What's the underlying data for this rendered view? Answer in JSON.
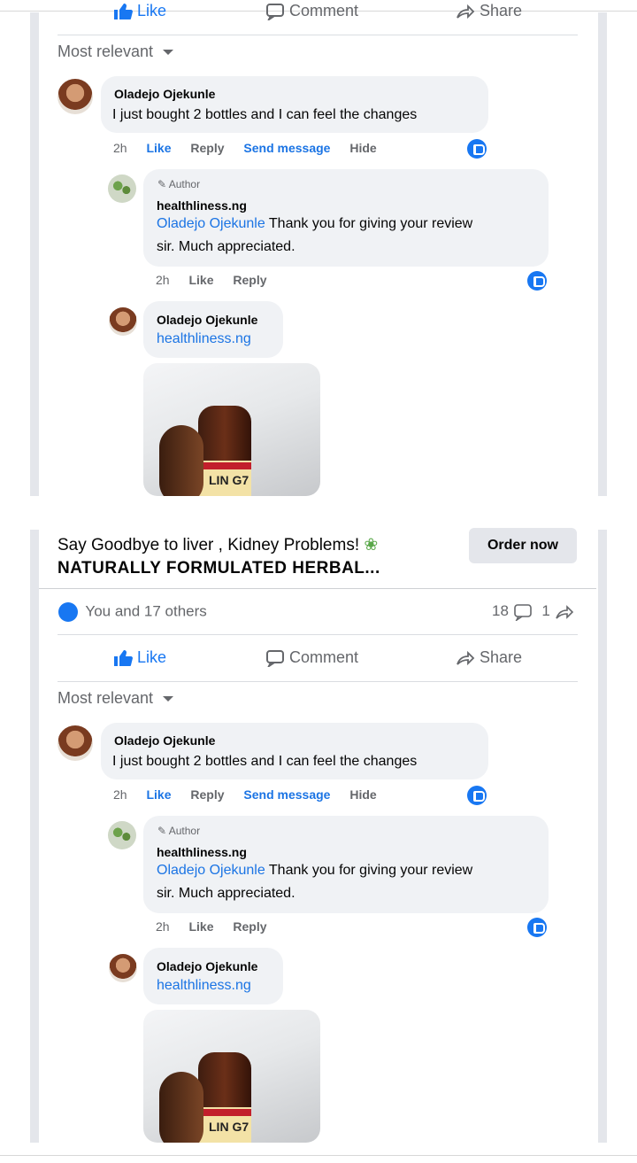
{
  "post": {
    "headline": "Say Goodbye to liver , Kidney Problems!",
    "subheadline": "NATURALLY FORMULATED HERBAL...",
    "cta_label": "Order now",
    "reactions_text": "You and 17 others",
    "comment_count": "18",
    "share_count": "1",
    "actions": {
      "like": "Like",
      "comment": "Comment",
      "share": "Share"
    },
    "sort_label": "Most relevant"
  },
  "comment": {
    "author": "Oladejo Ojekunle",
    "text": "I just bought 2 bottles and I can feel the changes",
    "time": "2h",
    "like": "Like",
    "reply": "Reply",
    "send_message": "Send message",
    "hide": "Hide"
  },
  "reply1": {
    "badge": "Author",
    "author": "healthliness.ng",
    "mention": "Oladejo Ojekunle",
    "text_line1": " Thank you for giving your review",
    "text_line2": "sir. Much appreciated.",
    "time": "2h",
    "like": "Like",
    "reply": "Reply"
  },
  "reply2": {
    "author": "Oladejo Ojekunle",
    "mention": "healthliness.ng",
    "image_label_text": "LIN G7"
  },
  "colors": {
    "accent": "#1877f2",
    "bubble": "#f0f2f5"
  }
}
